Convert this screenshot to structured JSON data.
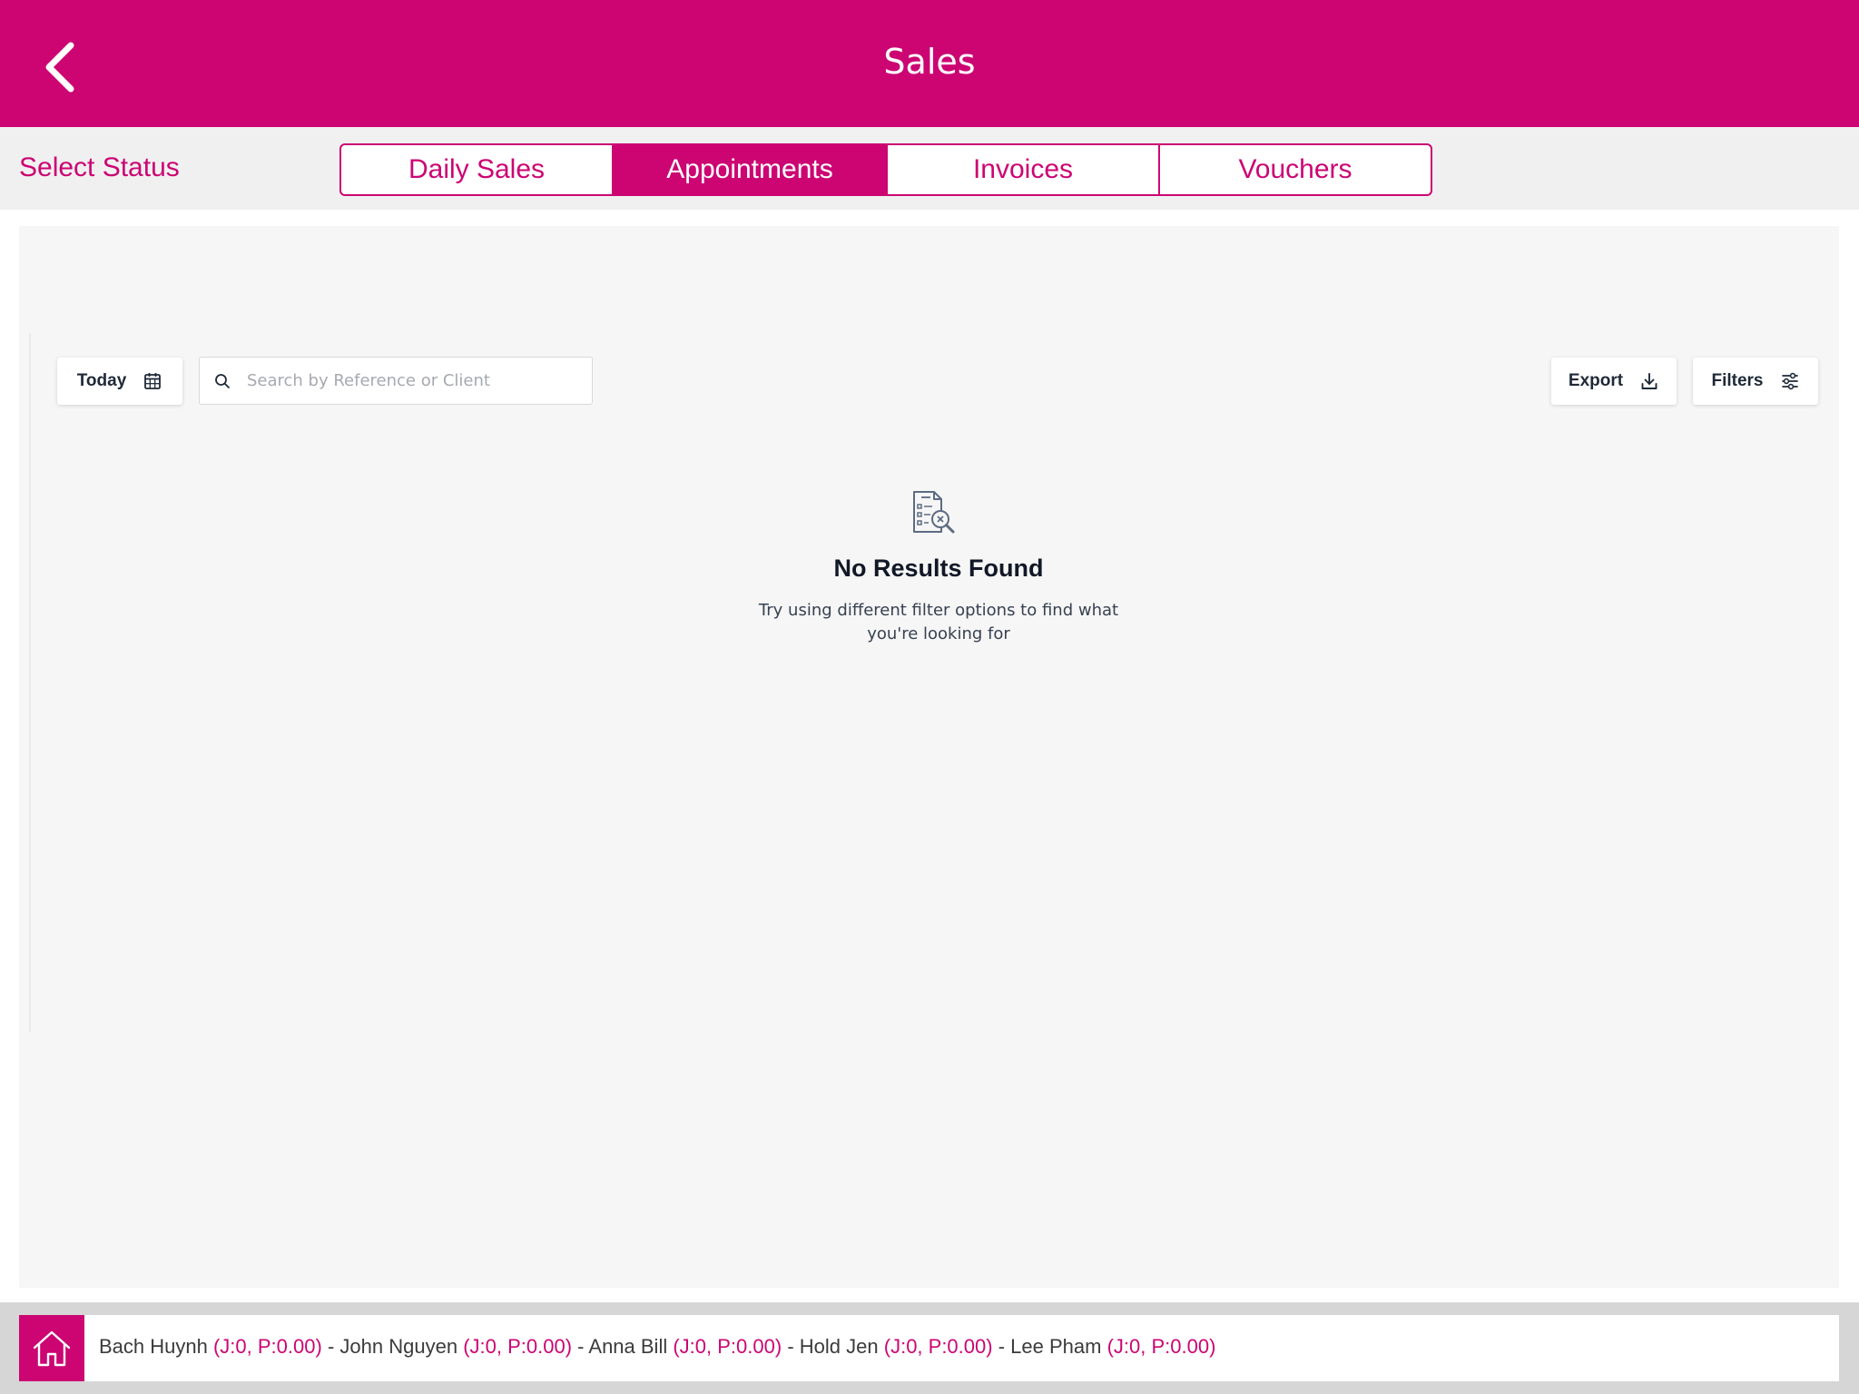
{
  "header": {
    "title": "Sales"
  },
  "status": {
    "label": "Select Status",
    "tabs": [
      "Daily Sales",
      "Appointments",
      "Invoices",
      "Vouchers"
    ],
    "active_tab": "Appointments"
  },
  "toolbar": {
    "date_label": "Today",
    "search_placeholder": "Search by Reference or Client",
    "export_label": "Export",
    "filters_label": "Filters"
  },
  "empty_state": {
    "title": "No Results Found",
    "message": "Try using different filter options to find what you're looking for"
  },
  "staff": [
    {
      "name": "Bach Huynh",
      "stats": "(J:0, P:0.00)"
    },
    {
      "name": "John Nguyen",
      "stats": "(J:0, P:0.00)"
    },
    {
      "name": "Anna Bill",
      "stats": "(J:0, P:0.00)"
    },
    {
      "name": "Hold Jen",
      "stats": "(J:0, P:0.00)"
    },
    {
      "name": "Lee Pham",
      "stats": "(J:0, P:0.00)"
    }
  ],
  "staff_separator": "-",
  "colors": {
    "brand": "#cc0573",
    "background": "#f6f6f6",
    "text": "#1f2937"
  },
  "icons": [
    "back-chevron-icon",
    "calendar-icon",
    "search-icon",
    "download-icon",
    "sliders-icon",
    "no-results-icon",
    "home-icon"
  ]
}
